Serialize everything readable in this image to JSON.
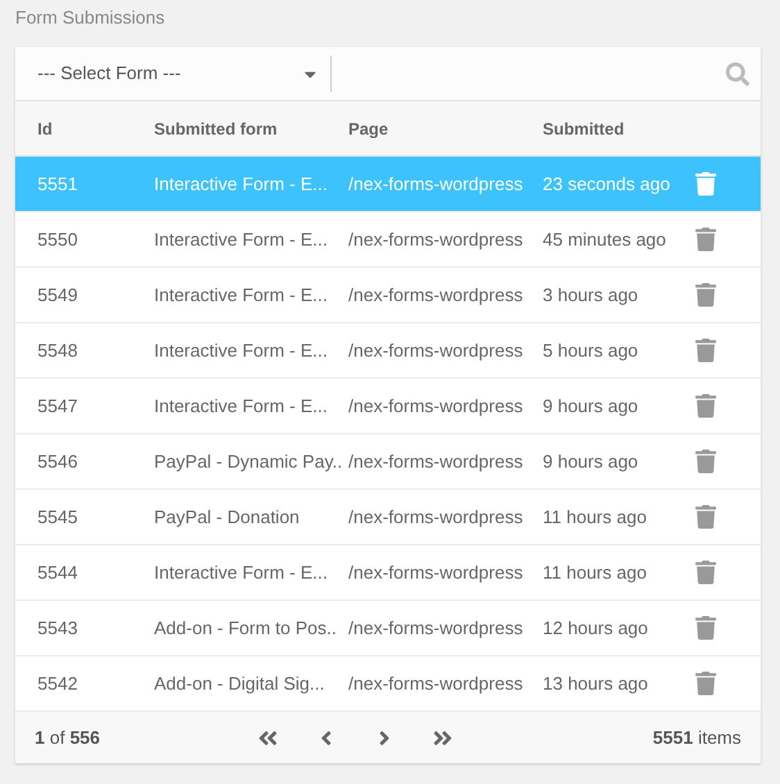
{
  "title": "Form Submissions",
  "filter": {
    "select": "--- Select Form ---"
  },
  "table": {
    "columns": [
      "Id",
      "Submitted form",
      "Page",
      "Submitted"
    ],
    "rows": [
      {
        "id": "5551",
        "form": "Interactive Form - E...",
        "page": "/nex-forms-wordpress",
        "submitted": "23 seconds ago",
        "selected": true
      },
      {
        "id": "5550",
        "form": "Interactive Form - E...",
        "page": "/nex-forms-wordpress",
        "submitted": "45 minutes ago",
        "selected": false
      },
      {
        "id": "5549",
        "form": "Interactive Form - E...",
        "page": "/nex-forms-wordpress",
        "submitted": "3 hours ago",
        "selected": false
      },
      {
        "id": "5548",
        "form": "Interactive Form - E...",
        "page": "/nex-forms-wordpress",
        "submitted": "5 hours ago",
        "selected": false
      },
      {
        "id": "5547",
        "form": "Interactive Form - E...",
        "page": "/nex-forms-wordpress",
        "submitted": "9 hours ago",
        "selected": false
      },
      {
        "id": "5546",
        "form": "PayPal - Dynamic Pay..",
        "page": "/nex-forms-wordpress",
        "submitted": "9 hours ago",
        "selected": false
      },
      {
        "id": "5545",
        "form": "PayPal - Donation",
        "page": "/nex-forms-wordpress",
        "submitted": "11 hours ago",
        "selected": false
      },
      {
        "id": "5544",
        "form": "Interactive Form - E...",
        "page": "/nex-forms-wordpress",
        "submitted": "11 hours ago",
        "selected": false
      },
      {
        "id": "5543",
        "form": "Add-on - Form to Pos..",
        "page": "/nex-forms-wordpress",
        "submitted": "12 hours ago",
        "selected": false
      },
      {
        "id": "5542",
        "form": "Add-on - Digital Sig...",
        "page": "/nex-forms-wordpress",
        "submitted": "13 hours ago",
        "selected": false
      }
    ]
  },
  "pager": {
    "page": "**1** of **556**",
    "items": "**5551** items"
  }
}
